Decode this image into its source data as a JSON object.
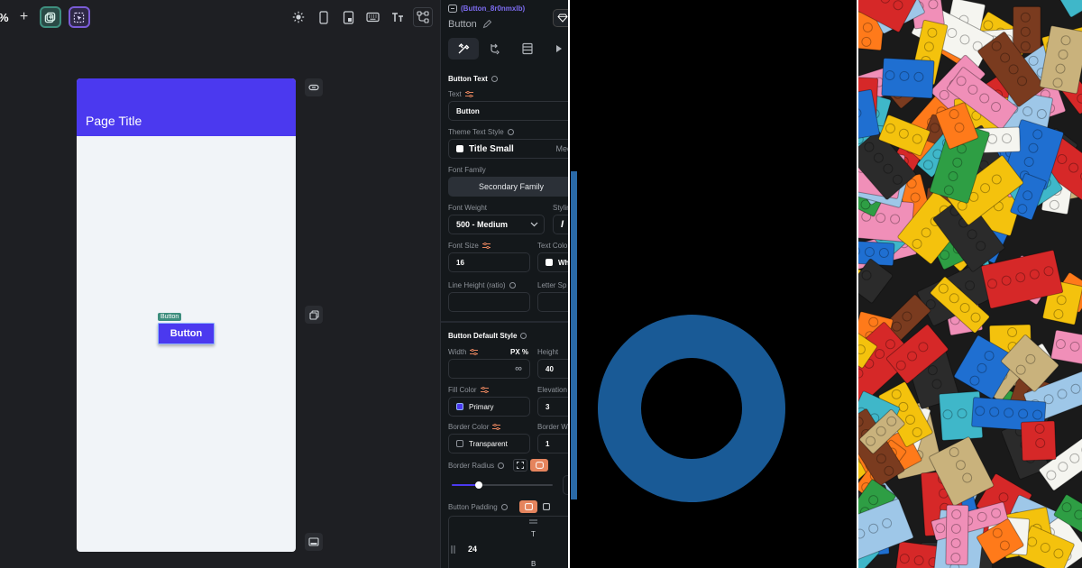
{
  "editor": {
    "zoom_suffix": "%",
    "add_symbol": "+",
    "toolbar_left_icons": [
      "add-widget-icon",
      "magic-select-icon"
    ],
    "toolbar_right_icons": [
      "sun-icon",
      "phone-icon",
      "tablet-icon",
      "keyboard-icon",
      "text-size-icon",
      "tree-icon"
    ]
  },
  "phone": {
    "page_title": "Page Title",
    "button_tag": "Button",
    "button_label": "Button",
    "appbar_color": "#4b39ef",
    "body_color": "#f1f4f8"
  },
  "panel": {
    "widget_id": "(Button_8r0nmxlb)",
    "widget_name": "Button",
    "tabs": [
      "properties-icon",
      "actions-icon",
      "backend-icon",
      "more-icon"
    ],
    "button_text_section": "Button Text",
    "text_label": "Text",
    "text_value": "Button",
    "theme_text_style_label": "Theme Text Style",
    "theme_text_style_value": "Title Small",
    "theme_text_style_size": "Medi",
    "font_family_label": "Font Family",
    "font_family_value": "Secondary Family",
    "font_weight_label": "Font Weight",
    "font_weight_value": "500 - Medium",
    "styling_label": "Stylin",
    "font_size_label": "Font Size",
    "font_size_value": "16",
    "text_color_label": "Text Colo",
    "text_color_value": "Wh",
    "line_height_label": "Line Height (ratio)",
    "letter_spacing_label": "Letter Sp",
    "default_style_section": "Button Default Style",
    "width_label": "Width",
    "width_units": "PX %",
    "width_value": "∞",
    "height_label": "Height",
    "height_value": "40",
    "fill_color_label": "Fill Color",
    "fill_color_value": "Primary",
    "elevation_label": "Elevation",
    "elevation_value": "3",
    "border_color_label": "Border Color",
    "border_color_value": "Transparent",
    "border_width_label": "Border W",
    "border_width_value": "1",
    "border_radius_label": "Border Radius",
    "border_radius_slider": 0.12,
    "button_padding_label": "Button Padding",
    "padding_top_label": "T",
    "padding_bottom_label": "B",
    "padding_left_value": "24",
    "primary_color": "#4b39ef",
    "accent_orange": "#e5845d"
  },
  "ring": {
    "color": "#195a96",
    "background": "#000000"
  }
}
